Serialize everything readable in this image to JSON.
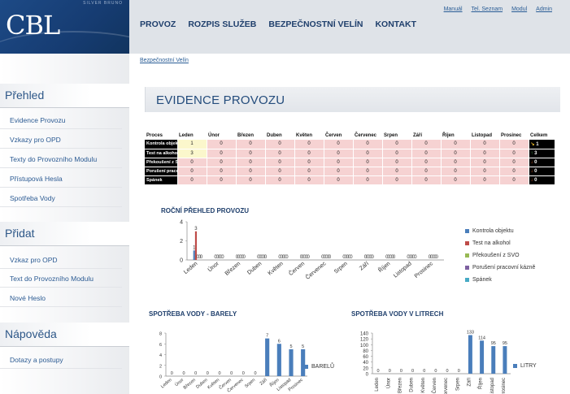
{
  "header": {
    "logo": "CBL",
    "logo_sub": "SILVER BRUNO",
    "nav": [
      "PROVOZ",
      "ROZPIS SLUŽEB",
      "BEZPEČNOSTNÍ VELÍN",
      "KONTAKT"
    ],
    "top_links": [
      "Manuál",
      "Tel. Seznam",
      "Modul",
      "Admin"
    ]
  },
  "sidebar": {
    "sections": [
      {
        "title": "Přehled",
        "items": [
          "Evidence Provozu",
          "Vzkazy pro OPD",
          "Texty do Provozního Modulu",
          "Přístupová Hesla",
          "Spotřeba Vody"
        ]
      },
      {
        "title": "Přidat",
        "items": [
          "Vzkaz pro OPD",
          "Text do Provozního Modulu",
          "Nové Heslo"
        ]
      },
      {
        "title": "Nápověda",
        "items": [
          "Dotazy a postupy"
        ]
      }
    ]
  },
  "breadcrumb": "Bezpečnostní Velín",
  "page_title": "EVIDENCE PROVOZU",
  "table": {
    "headers": [
      "Proces",
      "Leden",
      "Únor",
      "Březen",
      "Duben",
      "Květen",
      "Červen",
      "Červenec",
      "Srpen",
      "Září",
      "Říjen",
      "Listopad",
      "Prosinec",
      "Celkem"
    ],
    "rows": [
      {
        "label": "Kontrola objektu",
        "values": [
          "1",
          "0",
          "0",
          "0",
          "0",
          "0",
          "0",
          "0",
          "0",
          "0",
          "0",
          "0"
        ],
        "total": "1",
        "trend": "↘"
      },
      {
        "label": "Test na alkohol",
        "values": [
          "3",
          "0",
          "0",
          "0",
          "0",
          "0",
          "0",
          "0",
          "0",
          "0",
          "0",
          "0"
        ],
        "total": "3",
        "trend": "↑"
      },
      {
        "label": "Překoušení z SVO",
        "values": [
          "0",
          "0",
          "0",
          "0",
          "0",
          "0",
          "0",
          "0",
          "0",
          "0",
          "0",
          "0"
        ],
        "total": "0",
        "trend": "↓"
      },
      {
        "label": "Porušení pracovní kázně",
        "values": [
          "0",
          "0",
          "0",
          "0",
          "0",
          "0",
          "0",
          "0",
          "0",
          "0",
          "0",
          "0"
        ],
        "total": "0",
        "trend": "↓"
      },
      {
        "label": "Spánek",
        "values": [
          "0",
          "0",
          "0",
          "0",
          "0",
          "0",
          "0",
          "0",
          "0",
          "0",
          "0",
          "0"
        ],
        "total": "0",
        "trend": "↓"
      }
    ],
    "colors": {
      "trend_down": "#e0602a",
      "trend_up": "#4caf50",
      "trend_diag": "#e5b62a"
    }
  },
  "chart_data": [
    {
      "type": "bar",
      "title": "ROČNÍ PŘEHLED PROVOZU",
      "categories": [
        "Leden",
        "Únor",
        "Březen",
        "Duben",
        "Květen",
        "Červen",
        "Červenec",
        "Srpen",
        "Září",
        "Říjen",
        "Listopad",
        "Prosinec"
      ],
      "ylim": [
        0,
        4
      ],
      "yticks": [
        0,
        2,
        4
      ],
      "legend": "right",
      "series": [
        {
          "name": "Kontrola objektu",
          "color": "#4a7ebb",
          "values": [
            1,
            0,
            0,
            0,
            0,
            0,
            0,
            0,
            0,
            0,
            0,
            0
          ]
        },
        {
          "name": "Test na alkohol",
          "color": "#be4b48",
          "values": [
            3,
            0,
            0,
            0,
            0,
            0,
            0,
            0,
            0,
            0,
            0,
            0
          ]
        },
        {
          "name": "Překoušení z SVO",
          "color": "#98b954",
          "values": [
            0,
            0,
            0,
            0,
            0,
            0,
            0,
            0,
            0,
            0,
            0,
            0
          ]
        },
        {
          "name": "Porušení pracovní kázně",
          "color": "#7d60a0",
          "values": [
            0,
            0,
            0,
            0,
            0,
            0,
            0,
            0,
            0,
            0,
            0,
            0
          ]
        },
        {
          "name": "Spánek",
          "color": "#46aac5",
          "values": [
            0,
            0,
            0,
            0,
            0,
            0,
            0,
            0,
            0,
            0,
            0,
            0
          ]
        }
      ]
    },
    {
      "type": "bar",
      "title": "SPOTŘEBA VODY - BARELY",
      "categories": [
        "Leden",
        "Únor",
        "Březen",
        "Duben",
        "Květen",
        "Červen",
        "Červenec",
        "Srpen",
        "Září",
        "Říjen",
        "Listopad",
        "Prosinec"
      ],
      "ylim": [
        0,
        8
      ],
      "yticks": [
        0,
        2,
        4,
        6,
        8
      ],
      "legend": "right",
      "series": [
        {
          "name": "BARELŮ",
          "color": "#4a7ebb",
          "values": [
            0,
            0,
            0,
            0,
            0,
            0,
            0,
            0,
            7,
            6,
            5,
            5
          ]
        }
      ]
    },
    {
      "type": "bar",
      "title": "SPOTŘEBA VODY V LITRECH",
      "categories": [
        "Leden",
        "Únor",
        "Březen",
        "Duben",
        "Květen",
        "Červen",
        "Červenec",
        "Srpen",
        "Září",
        "Říjen",
        "Listopad",
        "Prosinec"
      ],
      "ylim": [
        0,
        140
      ],
      "yticks": [
        0,
        20,
        40,
        60,
        80,
        100,
        120,
        140
      ],
      "legend": "right",
      "series": [
        {
          "name": "LITRY",
          "color": "#4a7ebb",
          "values": [
            0,
            0,
            0,
            0,
            0,
            0,
            0,
            0,
            133,
            114,
            95,
            95
          ]
        }
      ]
    }
  ]
}
